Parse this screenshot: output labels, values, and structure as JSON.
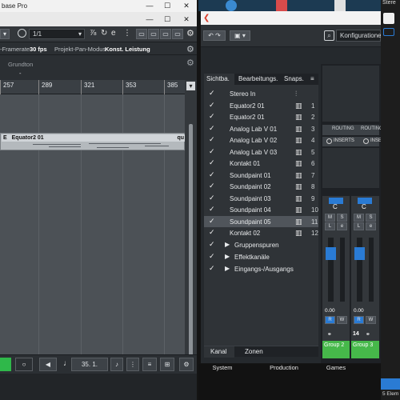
{
  "cubase": {
    "title": "base Pro",
    "position_field": "1/1",
    "infobar": {
      "framerate_label": "-Framerate",
      "framerate_value": "30 fps",
      "pan_mode": "Projekt-Pan-Modus",
      "const_power": "Konst. Leistung"
    },
    "grundton_label": "Grundton",
    "grundton_value": "-",
    "ruler_ticks": [
      "257",
      "289",
      "321",
      "353",
      "385"
    ],
    "clip": {
      "prefix": "E",
      "name": "Equator2 01",
      "suffix": "qu"
    },
    "transport": {
      "position": "35. 1."
    }
  },
  "mixer": {
    "config_field": "Konfiguratione.",
    "tabs": [
      "Sichtba.",
      "Bearbeitungs.",
      "Snaps."
    ],
    "tab_menu": "≡",
    "rows": [
      {
        "label": "Stereo In",
        "num": ""
      },
      {
        "label": "Equator2 01",
        "num": "1"
      },
      {
        "label": "Equator2 01",
        "num": "2"
      },
      {
        "label": "Analog Lab V 01",
        "num": "3"
      },
      {
        "label": "Analog Lab V 02",
        "num": "4"
      },
      {
        "label": "Analog Lab V 03",
        "num": "5"
      },
      {
        "label": "Kontakt 01",
        "num": "6"
      },
      {
        "label": "Soundpaint 01",
        "num": "7"
      },
      {
        "label": "Soundpaint 02",
        "num": "8"
      },
      {
        "label": "Soundpaint 03",
        "num": "9"
      },
      {
        "label": "Soundpaint 04",
        "num": "10"
      },
      {
        "label": "Soundpaint 05",
        "num": "11"
      },
      {
        "label": "Kontakt 02",
        "num": "12"
      }
    ],
    "groups": [
      "Gruppenspuren",
      "Effektkanäle",
      "Eingangs-/Ausgangs"
    ],
    "bottom_tabs": [
      "Kanal",
      "Zonen"
    ],
    "routing_label": "ROUTING",
    "inserts_label": "INSERTS",
    "strip_letter": "C",
    "strip_m": "M",
    "strip_s": "S",
    "strip_l": "L",
    "strip_r": "R",
    "strip_w": "W",
    "strip_e": "e",
    "fader_value": "0.00",
    "group_number": "14",
    "group_names": [
      "Group 2",
      "Group 3"
    ]
  },
  "desktop": {
    "dock_labels": [
      "System",
      "Production",
      "Games"
    ],
    "corner_text": "Stere",
    "bottom_right_text": "5 Elem"
  },
  "colors": {
    "cubase_bg": "#2b2f33",
    "selection": "#50555b",
    "transport_play": "#2fb84a",
    "group_green": "#46b84a",
    "clip": "#b4b9bd"
  }
}
